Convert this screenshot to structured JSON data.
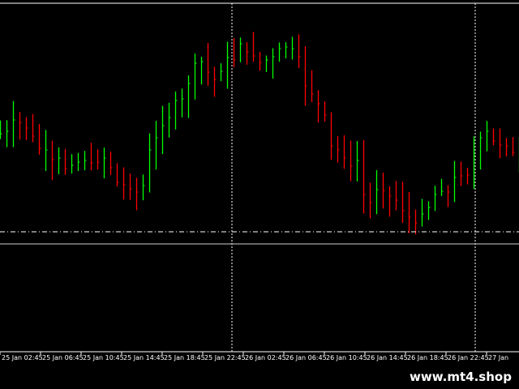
{
  "chart": {
    "colors": {
      "background": "#000000",
      "bull": "#00ff00",
      "bear": "#ff0000",
      "grid": "#ffffff",
      "axis_text": "#ffffff"
    },
    "time_labels": [
      "25 Jan 02:45",
      "25 Jan 06:45",
      "25 Jan 10:45",
      "25 Jan 14:45",
      "25 Jan 18:45",
      "25 Jan 22:45",
      "26 Jan 02:45",
      "26 Jan 06:45",
      "26 Jan 10:45",
      "26 Jan 14:45",
      "26 Jan 18:45",
      "26 Jan 22:45",
      "27 Jan"
    ],
    "close_series": [
      195,
      198,
      212,
      209,
      202,
      192,
      177,
      175,
      163,
      165,
      152,
      156,
      160,
      162,
      159,
      160,
      165,
      153,
      135,
      132,
      127,
      123,
      131,
      175,
      190,
      205,
      215,
      236,
      238,
      257,
      282,
      284,
      271,
      262,
      272,
      289,
      286,
      306,
      296,
      291,
      283,
      286,
      290,
      300,
      302,
      300,
      290,
      254,
      244,
      232,
      218,
      180,
      175,
      165,
      155,
      162,
      120,
      110,
      126,
      125,
      118,
      113,
      100,
      92,
      85,
      96,
      104,
      120,
      124,
      123,
      141,
      143,
      144,
      168,
      190,
      198,
      186,
      181,
      180,
      172,
      171
    ]
  },
  "watermark": {
    "text": "www.mt4.shop"
  }
}
